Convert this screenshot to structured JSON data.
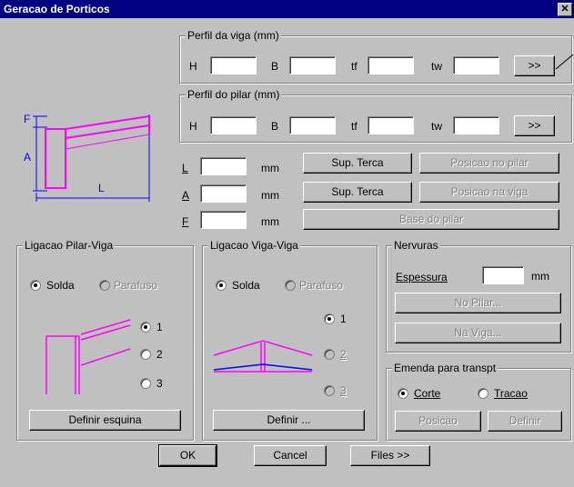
{
  "window": {
    "title": "Geracao de Porticos",
    "close": "✕"
  },
  "perfil_viga": {
    "title": "Perfil da viga (mm)",
    "h_label": "H",
    "b_label": "B",
    "tf_label": "tf",
    "tw_label": "tw",
    "h_value": "",
    "b_value": "",
    "tf_value": "",
    "tw_value": "",
    "more_label": ">>"
  },
  "perfil_pilar": {
    "title": "Perfil do pilar (mm)",
    "h_label": "H",
    "b_label": "B",
    "tf_label": "tf",
    "tw_label": "tw",
    "h_value": "",
    "b_value": "",
    "tf_value": "",
    "tw_value": "",
    "more_label": ">>"
  },
  "diagram": {
    "f_label": "F",
    "a_label": "A",
    "l_label": "L"
  },
  "dims": {
    "l_label": "L",
    "a_label": "A",
    "f_label": "F",
    "unit": "mm",
    "l_value": "",
    "a_value": "",
    "f_value": ""
  },
  "buttons_mid": {
    "sup_terca_1": "Sup. Terca",
    "sup_terca_2": "Sup. Terca",
    "posicao_pilar": "Posicao no pilar",
    "posicao_viga": "Posicao na viga",
    "base_pilar": "Base do pilar"
  },
  "lig_pilar_viga": {
    "title": "Ligacao Pilar-Viga",
    "solda": "Solda",
    "parafuso": "Parafuso",
    "opt1": "1",
    "opt2": "2",
    "opt3": "3",
    "definir": "Definir esquina"
  },
  "lig_viga_viga": {
    "title": "Ligacao Viga-Viga",
    "solda": "Solda",
    "parafuso": "Parafuso",
    "opt1": "1",
    "opt2": "2",
    "opt3": "3",
    "definir": "Definir ..."
  },
  "nervuras": {
    "title": "Nervuras",
    "espessura": "Espessura",
    "espessura_value": "",
    "unit": "mm",
    "no_pilar": "No Pilar...",
    "na_viga": "Na Viga..."
  },
  "emenda": {
    "title": "Emenda para transpt",
    "corte": "Corte",
    "tracao": "Tracao",
    "posicao": "Posicao",
    "definir": "Definir"
  },
  "footer": {
    "ok": "OK",
    "cancel": "Cancel",
    "files": "Files >>"
  },
  "colors": {
    "accent_magenta": "#ff00ff",
    "accent_blue": "#0000ff",
    "title_bar": "#000080"
  }
}
